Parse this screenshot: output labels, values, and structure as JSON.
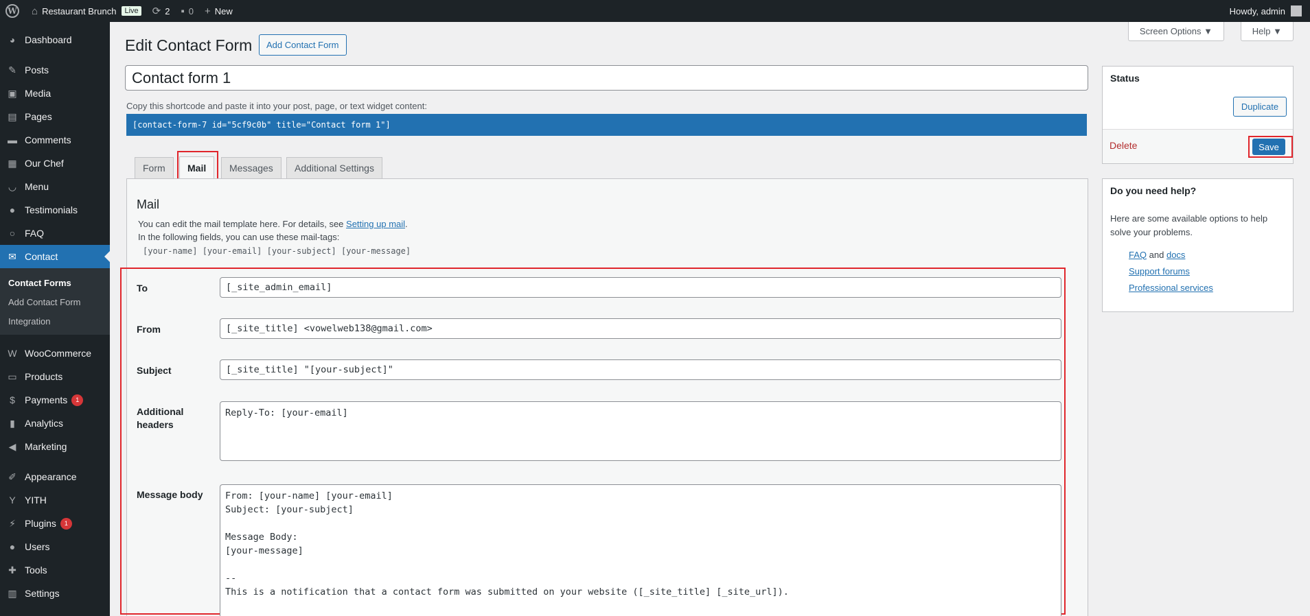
{
  "adminbar": {
    "site_name": "Restaurant Brunch",
    "live_label": "Live",
    "updates_count": "2",
    "comments_count": "0",
    "new_label": "New",
    "howdy": "Howdy, admin"
  },
  "sidebar": {
    "items": [
      {
        "label": "Dashboard",
        "icon": "dashboard-icon"
      },
      {
        "label": "Posts",
        "icon": "pin-icon"
      },
      {
        "label": "Media",
        "icon": "media-icon"
      },
      {
        "label": "Pages",
        "icon": "page-icon"
      },
      {
        "label": "Comments",
        "icon": "comment-icon"
      },
      {
        "label": "Our Chef",
        "icon": "store-icon"
      },
      {
        "label": "Menu",
        "icon": "smile-icon"
      },
      {
        "label": "Testimonials",
        "icon": "user-icon"
      },
      {
        "label": "FAQ",
        "icon": "circle-icon"
      },
      {
        "label": "Contact",
        "icon": "email-icon"
      }
    ],
    "submenu": [
      "Contact Forms",
      "Add Contact Form",
      "Integration"
    ],
    "items2": [
      {
        "label": "WooCommerce",
        "icon": "woo-icon"
      },
      {
        "label": "Products",
        "icon": "archive-icon"
      },
      {
        "label": "Payments",
        "icon": "dollar-icon",
        "badge": "1"
      },
      {
        "label": "Analytics",
        "icon": "chart-icon"
      },
      {
        "label": "Marketing",
        "icon": "megaphone-icon"
      }
    ],
    "items3": [
      {
        "label": "Appearance",
        "icon": "brush-icon"
      },
      {
        "label": "YITH",
        "icon": "yith-icon"
      },
      {
        "label": "Plugins",
        "icon": "plugin-icon",
        "badge": "1"
      },
      {
        "label": "Users",
        "icon": "users-icon"
      },
      {
        "label": "Tools",
        "icon": "wrench-icon"
      },
      {
        "label": "Settings",
        "icon": "settings-icon"
      }
    ]
  },
  "header": {
    "screen_options": "Screen Options ▼",
    "help": "Help ▼",
    "title": "Edit Contact Form",
    "add_new": "Add Contact Form"
  },
  "form": {
    "title_value": "Contact form 1",
    "shortcode_desc": "Copy this shortcode and paste it into your post, page, or text widget content:",
    "shortcode": "[contact-form-7 id=\"5cf9c0b\" title=\"Contact form 1\"]"
  },
  "tabs": [
    "Form",
    "Mail",
    "Messages",
    "Additional Settings"
  ],
  "mail": {
    "heading": "Mail",
    "desc_prefix": "You can edit the mail template here. For details, see ",
    "desc_link": "Setting up mail",
    "desc_suffix": ".",
    "desc2": "In the following fields, you can use these mail-tags:",
    "mailtags": "[your-name] [your-email] [your-subject] [your-message]",
    "to_label": "To",
    "to_value": "[_site_admin_email]",
    "from_label": "From",
    "from_value": "[_site_title] <vowelweb138@gmail.com>",
    "subject_label": "Subject",
    "subject_value": "[_site_title] \"[your-subject]\"",
    "headers_label_1": "Additional",
    "headers_label_2": "headers",
    "headers_value": "Reply-To: [your-email]",
    "body_label": "Message body",
    "body_value": "From: [your-name] [your-email]\nSubject: [your-subject]\n\nMessage Body:\n[your-message]\n\n--\nThis is a notification that a contact form was submitted on your website ([_site_title] [_site_url])."
  },
  "status_box": {
    "title": "Status",
    "duplicate": "Duplicate",
    "delete": "Delete",
    "save": "Save"
  },
  "help_box": {
    "title": "Do you need help?",
    "text": "Here are some available options to help solve your problems.",
    "item1_link1": "FAQ",
    "item1_and": "and",
    "item1_link2": "docs",
    "item2": "Support forums",
    "item3": "Professional services"
  }
}
